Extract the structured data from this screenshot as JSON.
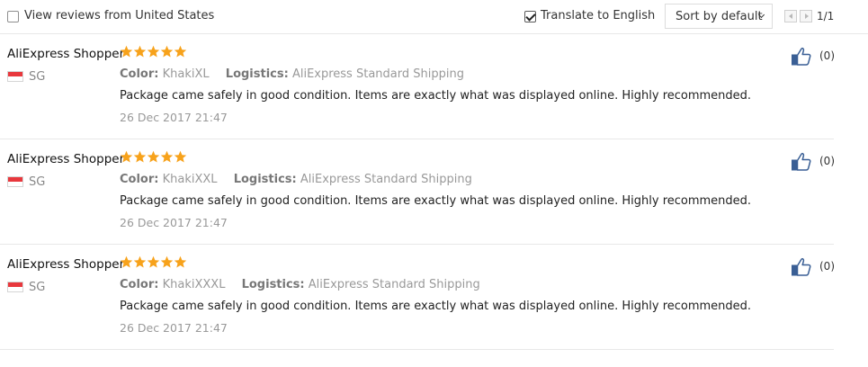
{
  "toolbar": {
    "filter_label": "View reviews from United States",
    "filter_checked": false,
    "translate_label": "Translate to English",
    "translate_checked": true,
    "sort_label": "Sort by default",
    "page_indicator": "1/1"
  },
  "reviews": [
    {
      "name": "AliExpress Shopper",
      "rating": 5,
      "country": "SG",
      "color_key": "Color:",
      "color_value": "KhakiXL",
      "logistics_key": "Logistics:",
      "logistics_value": "AliExpress Standard Shipping",
      "text": "Package came safely in good condition. Items are exactly what was displayed online. Highly recommended.",
      "date": "26 Dec 2017 21:47",
      "likes": "(0)"
    },
    {
      "name": "AliExpress Shopper",
      "rating": 5,
      "country": "SG",
      "color_key": "Color:",
      "color_value": "KhakiXXL",
      "logistics_key": "Logistics:",
      "logistics_value": "AliExpress Standard Shipping",
      "text": "Package came safely in good condition. Items are exactly what was displayed online. Highly recommended.",
      "date": "26 Dec 2017 21:47",
      "likes": "(0)"
    },
    {
      "name": "AliExpress Shopper",
      "rating": 5,
      "country": "SG",
      "color_key": "Color:",
      "color_value": "KhakiXXXL",
      "logistics_key": "Logistics:",
      "logistics_value": "AliExpress Standard Shipping",
      "text": "Package came safely in good condition. Items are exactly what was displayed online. Highly recommended.",
      "date": "26 Dec 2017 21:47",
      "likes": "(0)"
    }
  ],
  "colors": {
    "star": "#f7a21b",
    "flag_red": "#e8383d",
    "like_icon": "#3a5f95"
  },
  "icons": {
    "like": "thumbs-up-icon",
    "star": "star-icon",
    "flag": "singapore-flag-icon"
  }
}
